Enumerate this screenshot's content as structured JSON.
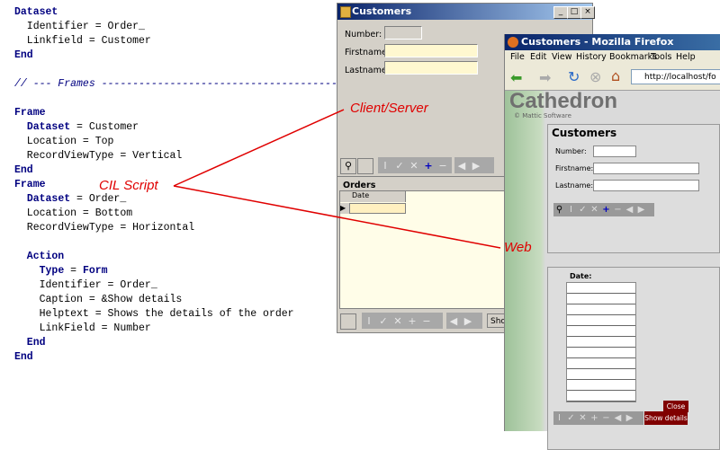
{
  "code_lines": [
    {
      "t": "Dataset",
      "c": "kw"
    },
    {
      "t": "  Identifier = Order_",
      "c": ""
    },
    {
      "t": "  Linkfield = Customer",
      "c": ""
    },
    {
      "t": "End",
      "c": "kw"
    },
    {
      "t": "",
      "c": ""
    },
    {
      "t": "// --- Frames -------------------------------------------",
      "c": "cm"
    },
    {
      "t": "",
      "c": ""
    },
    {
      "t": "Frame",
      "c": "kw"
    },
    {
      "t": "  Dataset = Customer",
      "c": "mix"
    },
    {
      "t": "  Location = Top",
      "c": ""
    },
    {
      "t": "  RecordViewType = Vertical",
      "c": ""
    },
    {
      "t": "End",
      "c": "kw"
    },
    {
      "t": "Frame",
      "c": "kw"
    },
    {
      "t": "  Dataset = Order_",
      "c": "mix"
    },
    {
      "t": "  Location = Bottom",
      "c": ""
    },
    {
      "t": "  RecordViewType = Horizontal",
      "c": ""
    },
    {
      "t": "",
      "c": ""
    },
    {
      "t": "  Action",
      "c": "kw"
    },
    {
      "t": "    Type = Form",
      "c": "mixform"
    },
    {
      "t": "    Identifier = Order_",
      "c": ""
    },
    {
      "t": "    Caption = &Show details",
      "c": ""
    },
    {
      "t": "    Helptext = Shows the details of the order",
      "c": ""
    },
    {
      "t": "    LinkField = Number",
      "c": ""
    },
    {
      "t": "  End",
      "c": "kw"
    },
    {
      "t": "End",
      "c": "kw"
    }
  ],
  "callouts": {
    "cil": "CIL Script",
    "client": "Client/Server",
    "web": "Web"
  },
  "client": {
    "title": "Customers",
    "min": "_",
    "max": "□",
    "close": "×",
    "number_label": "Number:",
    "firstname_label": "Firstname:",
    "lastname_label": "Lastname:",
    "orders_title": "Orders",
    "date_col": "Date",
    "show_btn": "Show"
  },
  "ff": {
    "title": "Customers - Mozilla Firefox",
    "menu": [
      "File",
      "Edit",
      "View",
      "History",
      "Bookmarks",
      "Tools",
      "Help"
    ],
    "url": "http://localhost/fo",
    "brand": "Cathedron",
    "brand_sub": "© Mattic Software",
    "section": "Customers",
    "number_label": "Number:",
    "firstname_label": "Firstname:",
    "lastname_label": "Lastname:",
    "date_label": "Date:",
    "show_details": "Show details",
    "close": "Close"
  },
  "colors": {
    "callout": "#e00000",
    "field": "#fff8d0",
    "panel": "#d4d0c8"
  }
}
